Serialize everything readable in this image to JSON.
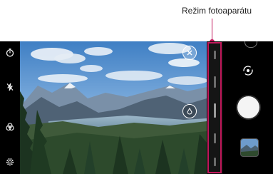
{
  "annotation": {
    "label": "Režim fotoaparátu"
  },
  "left_toolbar": {
    "icons": [
      "timer-icon",
      "flash-off-icon",
      "filter-icon",
      "settings-icon"
    ]
  },
  "viewfinder": {
    "icons": [
      "close-icon",
      "focus-lock-icon"
    ]
  },
  "mode_strip": {
    "highlight_color": "#c2185b"
  },
  "right_panel": {
    "icons": [
      "switch-camera-icon",
      "shutter-button",
      "gallery-thumbnail"
    ]
  }
}
